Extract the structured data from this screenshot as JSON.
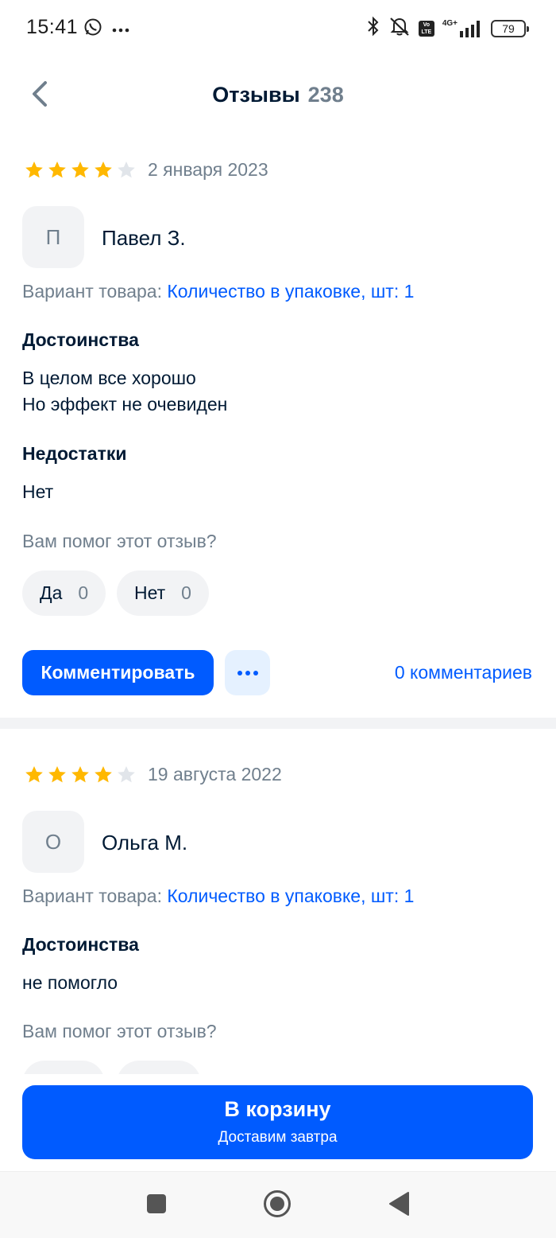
{
  "status_bar": {
    "time": "15:41",
    "left_icons": [
      "whatsapp-icon",
      "more-dots-icon"
    ],
    "right_icons": [
      "bluetooth-icon",
      "silent-icon",
      "volte-icon",
      "signal-icon",
      "battery-icon"
    ],
    "volte_label": "Vo LTE",
    "network_label": "4G+",
    "battery_level": "79"
  },
  "header": {
    "title": "Отзывы",
    "count": "238",
    "back_icon": "chevron-left-icon"
  },
  "colors": {
    "accent": "#005bff",
    "star_filled": "#ffb800",
    "star_empty": "#e1e5ea",
    "text_primary": "#001a34",
    "text_secondary": "#707f8d",
    "chip_bg": "#f2f3f5"
  },
  "reviews": [
    {
      "rating": 4,
      "max_rating": 5,
      "date": "2 января 2023",
      "avatar_letter": "П",
      "author": "Павел З.",
      "variant_label": "Вариант товара:",
      "variant_value": "Количество в упаковке, шт: 1",
      "pros_title": "Достоинства",
      "pros_text": "В целом все хорошо\nНо эффект не очевиден",
      "cons_title": "Недостатки",
      "cons_text": "Нет",
      "helpful_question": "Вам помог этот отзыв?",
      "yes_label": "Да",
      "yes_count": "0",
      "no_label": "Нет",
      "no_count": "0",
      "comment_button": "Комментировать",
      "comments_count": "0 комментариев"
    },
    {
      "rating": 4,
      "max_rating": 5,
      "date": "19 августа 2022",
      "avatar_letter": "О",
      "author": "Ольга М.",
      "variant_label": "Вариант товара:",
      "variant_value": "Количество в упаковке, шт: 1",
      "pros_title": "Достоинства",
      "pros_text": "не помогло",
      "helpful_question": "Вам помог этот отзыв?"
    }
  ],
  "cart": {
    "title": "В корзину",
    "subtitle": "Доставим завтра"
  },
  "nav_bar": {
    "buttons": [
      "recents-square-icon",
      "home-circle-icon",
      "back-triangle-icon"
    ]
  }
}
